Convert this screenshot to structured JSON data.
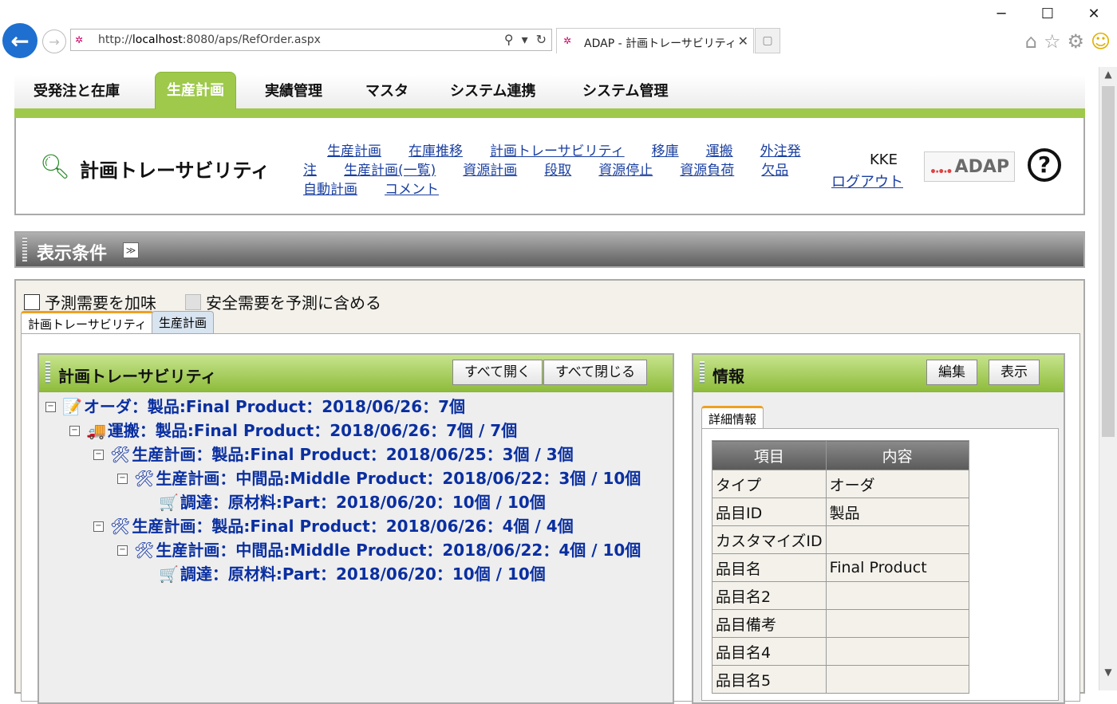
{
  "browser": {
    "url_prefix": "http://",
    "url_host": "localhost",
    "url_rest": ":8080/aps/RefOrder.aspx",
    "tab_title": "ADAP - 計画トレーサビリティ"
  },
  "menu": {
    "items": [
      {
        "label": "受発注と在庫"
      },
      {
        "label": "生産計画"
      },
      {
        "label": "実績管理"
      },
      {
        "label": "マスタ"
      },
      {
        "label": "システム連携"
      },
      {
        "label": "システム管理"
      }
    ]
  },
  "header": {
    "title": "計画トレーサビリティ",
    "links": [
      "生産計画",
      "在庫推移",
      "計画トレーサビリティ",
      "移庫",
      "運搬",
      "外注発注",
      "生産計画(一覧)",
      "資源計画",
      "段取",
      "資源停止",
      "資源負荷",
      "欠品",
      "自動計画",
      "コメント"
    ],
    "user": "KKE",
    "logout": "ログアウト",
    "logo": "ADAP",
    "help": "?"
  },
  "conditions": {
    "title": "表示条件"
  },
  "options": {
    "forecast": "予測需要を加味",
    "safety": "安全需要を予測に含める"
  },
  "subtabs": [
    "計画トレーサビリティ",
    "生産計画"
  ],
  "tree_panel": {
    "title": "計画トレーサビリティ",
    "open_all": "すべて開く",
    "close_all": "すべて閉じる",
    "nodes": [
      {
        "text": "オーダ：製品:Final Product：2018/06/26：7個"
      },
      {
        "text": "運搬：製品:Final Product：2018/06/26：7個 / 7個"
      },
      {
        "text": "生産計画：製品:Final Product：2018/06/25：3個 / 3個"
      },
      {
        "text": "生産計画：中間品:Middle Product：2018/06/22：3個 / 10個"
      },
      {
        "text": "調達：原材料:Part：2018/06/20：10個 / 10個"
      },
      {
        "text": "生産計画：製品:Final Product：2018/06/26：4個 / 4個"
      },
      {
        "text": "生産計画：中間品:Middle Product：2018/06/22：4個 / 10個"
      },
      {
        "text": "調達：原材料:Part：2018/06/20：10個 / 10個"
      }
    ]
  },
  "info_panel": {
    "title": "情報",
    "edit": "編集",
    "view": "表示",
    "tab": "詳細情報",
    "col_item": "項目",
    "col_content": "内容",
    "rows": [
      {
        "k": "タイプ",
        "v": "オーダ"
      },
      {
        "k": "品目ID",
        "v": "製品"
      },
      {
        "k": "カスタマイズID",
        "v": ""
      },
      {
        "k": "品目名",
        "v": "Final Product"
      },
      {
        "k": "品目名2",
        "v": ""
      },
      {
        "k": "品目備考",
        "v": ""
      },
      {
        "k": "品目名4",
        "v": ""
      },
      {
        "k": "品目名5",
        "v": ""
      }
    ]
  }
}
